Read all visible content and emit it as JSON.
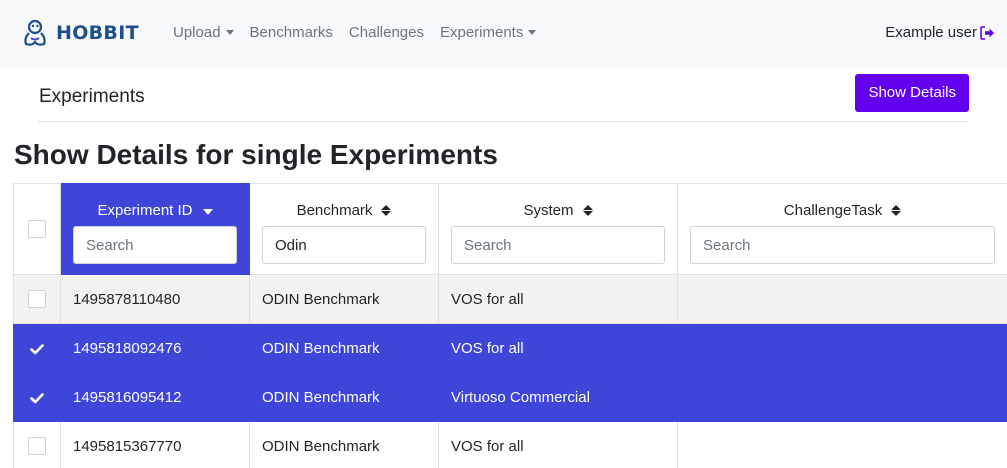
{
  "navbar": {
    "brand": "HOBBIT",
    "brand_icon": "hobbit-logo-icon",
    "links": [
      {
        "label": "Upload",
        "dropdown": true
      },
      {
        "label": "Benchmarks",
        "dropdown": false
      },
      {
        "label": "Challenges",
        "dropdown": false
      },
      {
        "label": "Experiments",
        "dropdown": true
      }
    ],
    "user": "Example user",
    "user_icon": "sign-out-icon"
  },
  "subheader": {
    "title": "Experiments",
    "button_label": "Show Details"
  },
  "page_title": "Show Details for single Experiments",
  "table": {
    "columns": [
      {
        "label": "Experiment ID",
        "filter_value": "",
        "filter_placeholder": "Search",
        "sorted": "desc"
      },
      {
        "label": "Benchmark",
        "filter_value": "Odin",
        "filter_placeholder": "Search",
        "sorted": "none"
      },
      {
        "label": "System",
        "filter_value": "",
        "filter_placeholder": "Search",
        "sorted": "none"
      },
      {
        "label": "ChallengeTask",
        "filter_value": "",
        "filter_placeholder": "Search",
        "sorted": "none"
      }
    ],
    "rows": [
      {
        "id": "1495878110480",
        "benchmark": "ODIN Benchmark",
        "system": "VOS for all",
        "challenge_task": "",
        "selected": false
      },
      {
        "id": "1495818092476",
        "benchmark": "ODIN Benchmark",
        "system": "VOS for all",
        "challenge_task": "",
        "selected": true
      },
      {
        "id": "1495816095412",
        "benchmark": "ODIN Benchmark",
        "system": "Virtuoso Commercial",
        "challenge_task": "",
        "selected": true
      },
      {
        "id": "1495815367770",
        "benchmark": "ODIN Benchmark",
        "system": "VOS for all",
        "challenge_task": "",
        "selected": false
      }
    ]
  },
  "colors": {
    "primary_button": "#6200ee",
    "selection": "#3e45d8",
    "brand": "#1d4f8a",
    "navbar_bg": "#f8f9fa"
  }
}
